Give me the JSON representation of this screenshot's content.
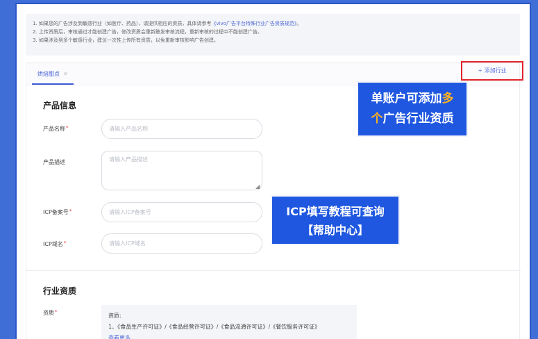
{
  "notice": {
    "line1_prefix": "1. 如果您的广告涉及到敏感行业（如医疗、药品），请提供相应的资质，具体请参考",
    "line1_link": "《vivo广告平台特殊行业广告资质规范》",
    "line1_suffix": "。",
    "line2": "2. 上传资质后，审核通过才能创建广告，修改资质会重新触发审核流程，重新审核的过程中不能创建广告。",
    "line3": "3. 如果涉及到多个敏感行业，建议一次性上传所有资质，以免重新审核影响广告创建。"
  },
  "tabs": [
    {
      "label": "烘焙甜点"
    }
  ],
  "add_industry_label": "+ 添加行业",
  "product_section": {
    "title": "产品信息",
    "product_name": {
      "label": "产品名称",
      "placeholder": "请输入产品名称"
    },
    "product_desc": {
      "label": "产品描述",
      "placeholder": "请输入产品描述"
    },
    "icp_number": {
      "label": "ICP备案号",
      "placeholder": "请输入ICP备案号"
    },
    "icp_domain": {
      "label": "ICP域名",
      "placeholder": "请输入ICP域名"
    }
  },
  "industry_section": {
    "title": "行业资质",
    "qual_label": "资质",
    "qual_heading": "资质:",
    "qual_list": "1、《食品生产许可证》/《食品经营许可证》/《食品流通许可证》/《餐饮服务许可证》",
    "more": "查看更多"
  },
  "callouts": {
    "multi": {
      "line1_text": "单账户可添加",
      "line1_hl": "多",
      "line2_hl": "个",
      "line2_text": "广告行业资质"
    },
    "icp": {
      "line1": "ICP填写教程可查询",
      "line2": "【帮助中心】"
    }
  },
  "colors": {
    "accent": "#3d5bd1",
    "callout_bg": "#1f57e0",
    "highlight": "#ffb21e",
    "required": "#e0232a"
  }
}
